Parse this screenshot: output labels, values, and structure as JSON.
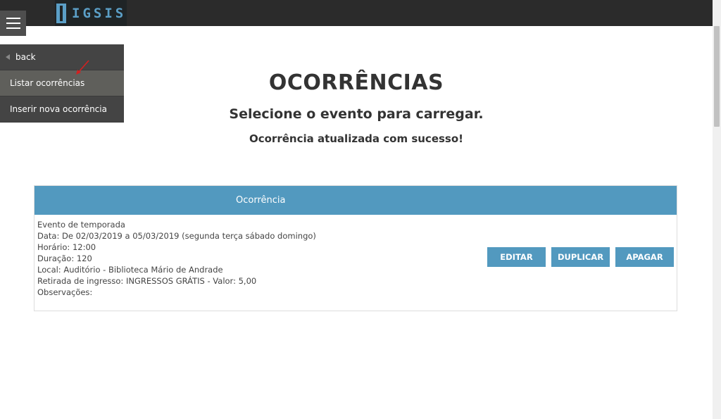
{
  "header": {
    "logo_text": "IGSIS"
  },
  "sidemenu": {
    "back_label": "back",
    "items": [
      {
        "label": "Listar ocorrências"
      },
      {
        "label": "Inserir nova ocorrência"
      }
    ]
  },
  "main": {
    "title": "OCORRÊNCIAS",
    "subtitle": "Selecione o evento para carregar.",
    "message": "Ocorrência atualizada com sucesso!"
  },
  "table": {
    "header": "Ocorrência",
    "row": {
      "lines": [
        "Evento de temporada",
        "Data: De 02/03/2019 a 05/03/2019 (segunda terça sábado domingo)",
        "Horário: 12:00",
        "Duração: 120",
        "Local: Auditório - Biblioteca Mário de Andrade",
        "Retirada de ingresso: INGRESSOS GRÁTIS - Valor: 5,00",
        "Observações:"
      ],
      "edit_label": "EDITAR",
      "duplicate_label": "DUPLICAR",
      "delete_label": "APAGAR"
    }
  },
  "colors": {
    "accent": "#5299bf",
    "topbar": "#2b2b2b",
    "menu": "#444444"
  }
}
